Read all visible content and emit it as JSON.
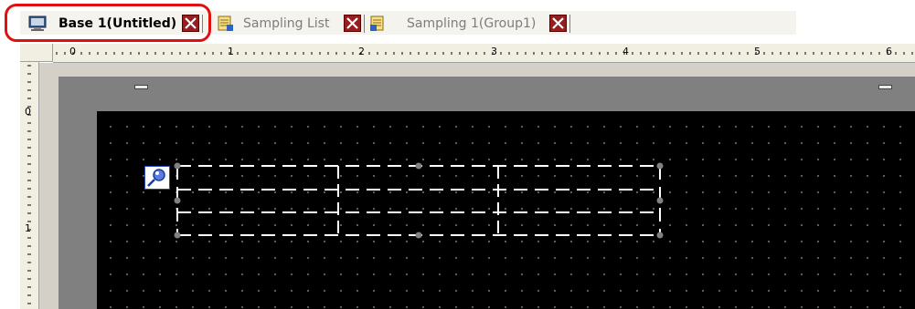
{
  "tabs": [
    {
      "label": "Base 1(Untitled)",
      "icon": "base-screen-icon",
      "active": true
    },
    {
      "label": "Sampling List",
      "icon": "sampling-list-icon",
      "active": false
    },
    {
      "label": "Sampling 1(Group1)",
      "icon": "sampling-group-icon",
      "active": false
    }
  ],
  "ruler": {
    "horizontal_labels": [
      "0",
      "1",
      "2",
      "3",
      "4",
      "5",
      "6"
    ],
    "vertical_labels": [
      "0",
      "1"
    ]
  },
  "colors": {
    "highlight": "#e01010",
    "close_button": "#9a1d1d",
    "screen_background": "#000000"
  },
  "canvas": {
    "part_icon": "lens-zoom-icon",
    "part": "dashed-table-part"
  }
}
